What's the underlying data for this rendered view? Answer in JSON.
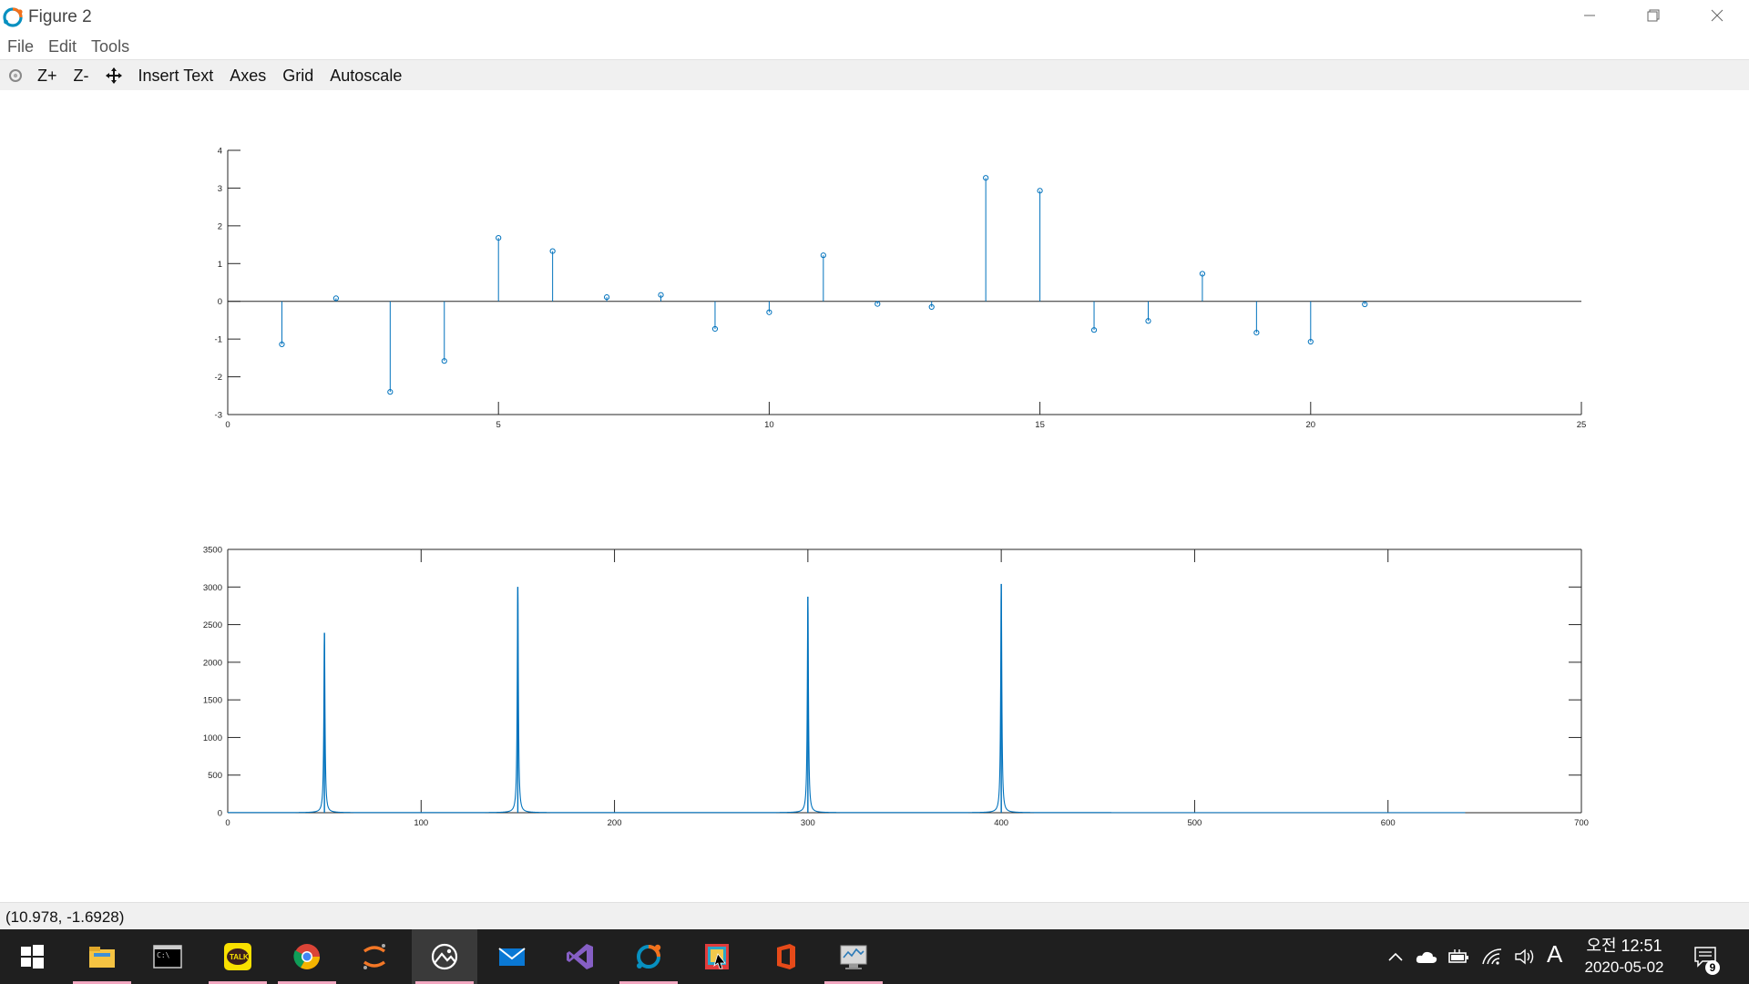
{
  "window": {
    "title": "Figure 2"
  },
  "menu": {
    "items": [
      "File",
      "Edit",
      "Tools"
    ]
  },
  "toolbar": {
    "zoom_in": "Z+",
    "zoom_out": "Z-",
    "insert_text": "Insert Text",
    "axes": "Axes",
    "grid": "Grid",
    "autoscale": "Autoscale"
  },
  "status": {
    "coords": "(10.978, -1.6928)"
  },
  "taskbar": {
    "apps": [
      {
        "name": "file-explorer-icon",
        "active": false,
        "underline": true
      },
      {
        "name": "terminal-icon",
        "active": false,
        "underline": false
      },
      {
        "name": "kakaotalk-icon",
        "active": false,
        "underline": true
      },
      {
        "name": "chrome-icon",
        "active": false,
        "underline": true
      },
      {
        "name": "jupyter-icon",
        "active": false,
        "underline": false
      },
      {
        "name": "photos-icon",
        "active": true,
        "underline": true
      },
      {
        "name": "mail-icon",
        "active": false,
        "underline": false
      },
      {
        "name": "visual-studio-icon",
        "active": false,
        "underline": false
      },
      {
        "name": "octave-icon",
        "active": false,
        "underline": true
      },
      {
        "name": "snipping-tool-icon",
        "active": false,
        "underline": false
      },
      {
        "name": "office-icon",
        "active": false,
        "underline": false
      },
      {
        "name": "monitor-app-icon",
        "active": false,
        "underline": true
      }
    ],
    "ime_indicator": "A",
    "clock_time": "오전 12:51",
    "clock_date": "2020-05-02",
    "notification_count": "9"
  },
  "colors": {
    "plot_line": "#0072bd",
    "taskbar_bg": "#1f1f1f",
    "toolbar_bg": "#f0f0f0"
  },
  "chart_data": [
    {
      "type": "stem",
      "title": "",
      "xlabel": "",
      "ylabel": "",
      "xlim": [
        0,
        25
      ],
      "ylim": [
        -3,
        4
      ],
      "xticks": [
        0,
        5,
        10,
        15,
        20,
        25
      ],
      "yticks": [
        -3,
        -2,
        -1,
        0,
        1,
        2,
        3,
        4
      ],
      "x": [
        1,
        2,
        3,
        4,
        5,
        6,
        7,
        8,
        9,
        10,
        11,
        12,
        13,
        14,
        15,
        16,
        17,
        18,
        19,
        20,
        21
      ],
      "values": [
        -1.14,
        0.08,
        -2.4,
        -1.58,
        1.68,
        1.33,
        0.11,
        0.17,
        -0.73,
        -0.29,
        1.22,
        -0.07,
        -0.15,
        3.27,
        2.93,
        -0.76,
        -0.52,
        0.73,
        -0.83,
        -1.07,
        -0.08
      ],
      "grid": false,
      "legend": "none"
    },
    {
      "type": "line",
      "title": "",
      "xlabel": "",
      "ylabel": "",
      "xlim": [
        0,
        700
      ],
      "ylim": [
        0,
        3500
      ],
      "xticks": [
        0,
        100,
        200,
        300,
        400,
        500,
        600,
        700
      ],
      "yticks": [
        0,
        500,
        1000,
        1500,
        2000,
        2500,
        3000,
        3500
      ],
      "peaks": [
        {
          "x": 50,
          "y": 2390
        },
        {
          "x": 150,
          "y": 3000
        },
        {
          "x": 300,
          "y": 2870
        },
        {
          "x": 400,
          "y": 3040
        }
      ],
      "grid": false,
      "legend": "none"
    }
  ]
}
